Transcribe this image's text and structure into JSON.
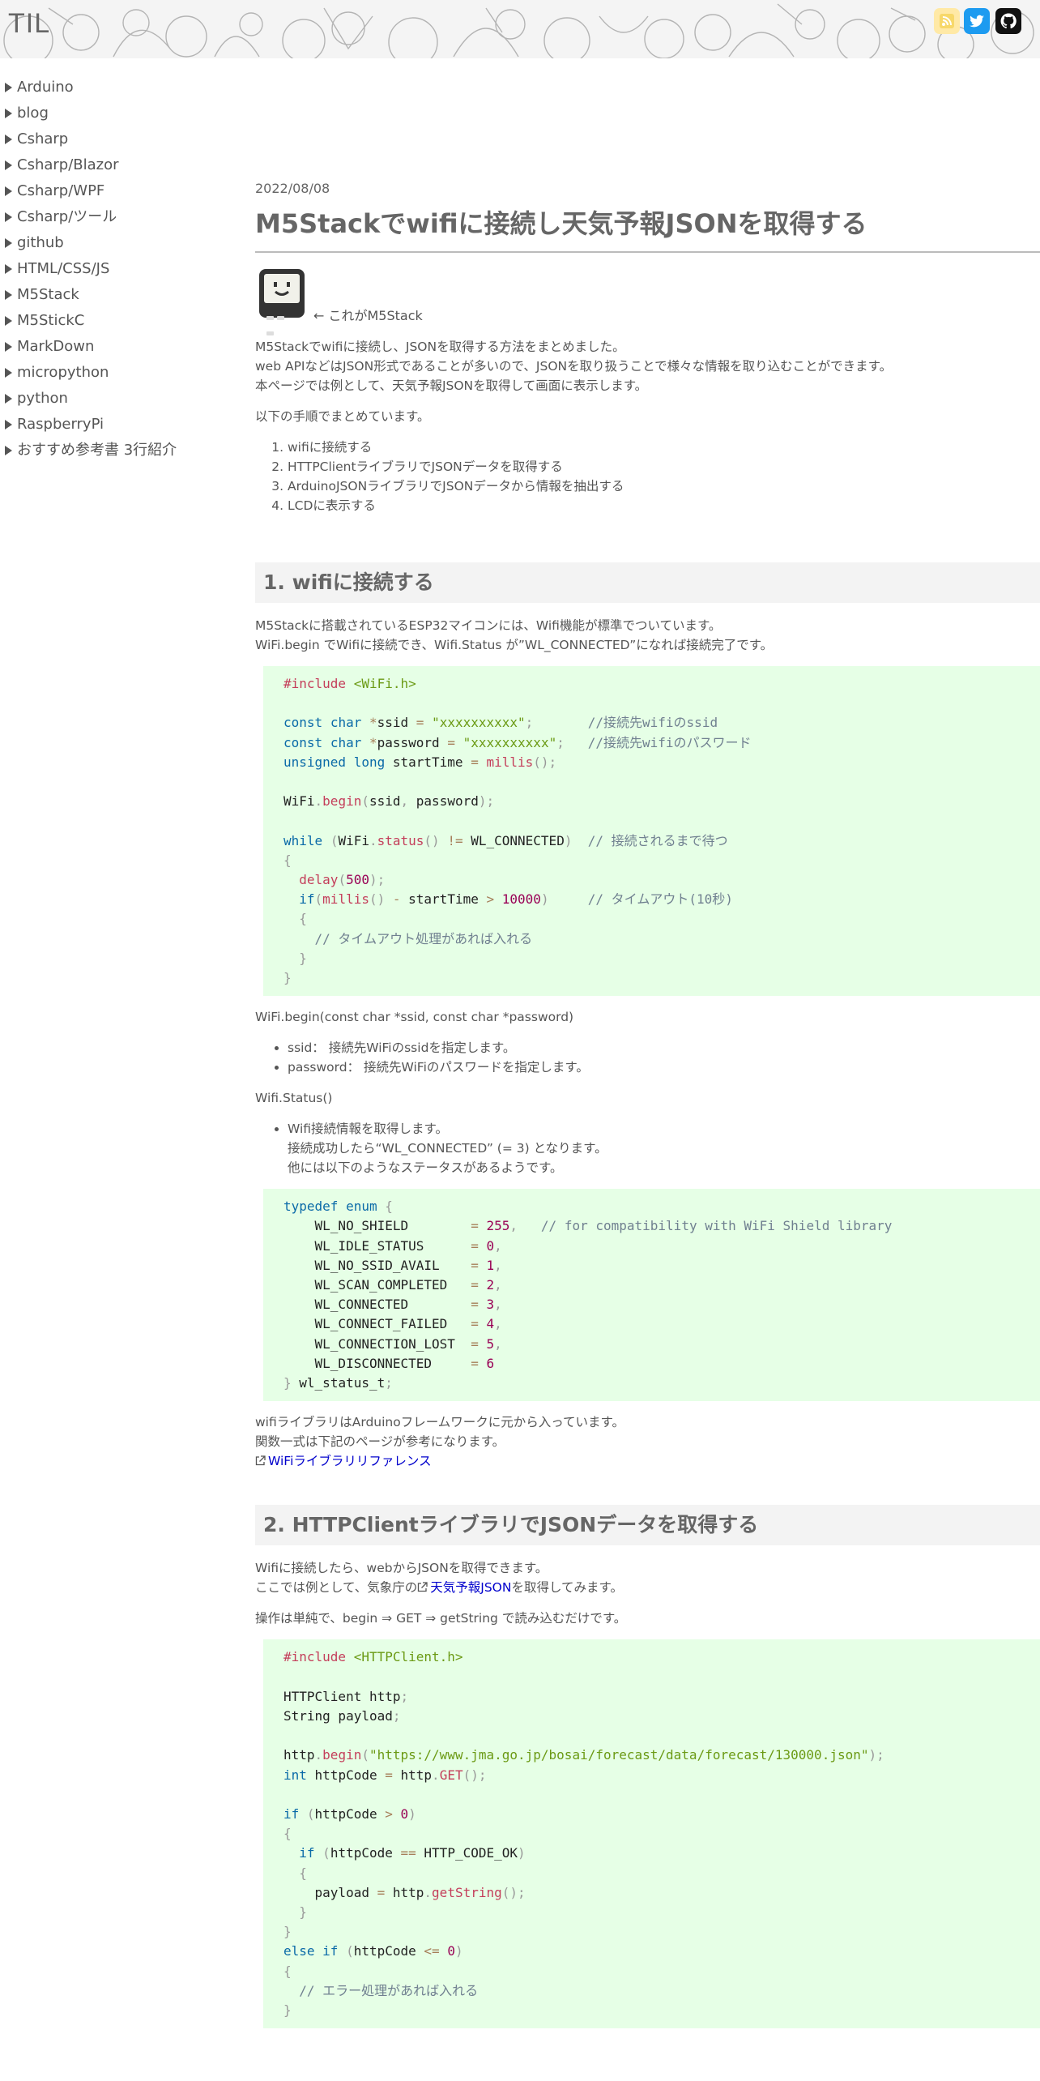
{
  "site": {
    "title": "TIL"
  },
  "sidebar": {
    "items": [
      "Arduino",
      "blog",
      "Csharp",
      "Csharp/Blazor",
      "Csharp/WPF",
      "Csharp/ツール",
      "github",
      "HTML/CSS/JS",
      "M5Stack",
      "M5StickC",
      "MarkDown",
      "micropython",
      "python",
      "RaspberryPi",
      "おすすめ参考書 3行紹介"
    ]
  },
  "article": {
    "date": "2022/08/08",
    "title": "M5Stackでwifiに接続し天気予報JSONを取得する",
    "image_caption": "← これがM5Stack",
    "intro": [
      "M5Stackでwifiに接続し、JSONを取得する方法をまとめました。",
      "web APIなどはJSON形式であることが多いので、JSONを取り扱うことで様々な情報を取り込むことができます。",
      "本ページでは例として、天気予報JSONを取得して画面に表示します。"
    ],
    "steps_intro": "以下の手順でまとめています。",
    "steps": [
      "wifiに接続する",
      "HTTPClientライブラリでJSONデータを取得する",
      "ArduinoJSONライブラリでJSONデータから情報を抽出する",
      "LCDに表示する"
    ],
    "section1": {
      "heading": "1. wifiに接続する",
      "lines": [
        "M5Stackに搭載されているESP32マイコンには、Wifi機能が標準でついています。",
        "WiFi.begin でWifiに接続でき、Wifi.Status が”WL_CONNECTED”になれば接続完了です。"
      ],
      "begin_sig": "WiFi.begin(const char *ssid, const char *password)",
      "begin_params": [
        "ssid： 接続先WiFiのssidを指定します。",
        "password： 接続先WiFiのパスワードを指定します。"
      ],
      "status_sig": "Wifi.Status()",
      "status_desc": [
        "Wifi接続情報を取得します。",
        "接続成功したら“WL_CONNECTED” (= 3) となります。",
        "他には以下のようなステータスがあるようです。"
      ],
      "after_lines": [
        "wifiライブラリはArduinoフレームワークに元から入っています。",
        "関数一式は下記のページが参考になります。"
      ],
      "ref_link": "WiFiライブラリリファレンス"
    },
    "section2": {
      "heading": "2. HTTPClientライブラリでJSONデータを取得する",
      "line1": "Wifiに接続したら、webからJSONを取得できます。",
      "line2_pre": "ここでは例として、気象庁の",
      "line2_link": "天気予報JSON",
      "line2_post": "を取得してみます。",
      "line3": "操作は単純で、begin ⇒ GET ⇒ getString で読み込むだけです。"
    },
    "code1": {
      "include": "#include",
      "include_file": "<WiFi.h>",
      "ssid_val": "\"xxxxxxxxxx\"",
      "pw_val": "\"xxxxxxxxxx\"",
      "c_ssid": "//接続先wifiのssid",
      "c_pw": "//接続先wifiのパスワード",
      "c_wait": "// 接続されるまで待つ",
      "c_timeout": "// タイムアウト(10秒)",
      "c_handle": "// タイムアウト処理があれば入れる",
      "n500": "500",
      "n10000": "10000"
    },
    "code2": {
      "comment": "// for compatibility with WiFi Shield library",
      "entries": [
        {
          "name": "WL_NO_SHIELD",
          "value": "255"
        },
        {
          "name": "WL_IDLE_STATUS",
          "value": "0"
        },
        {
          "name": "WL_NO_SSID_AVAIL",
          "value": "1"
        },
        {
          "name": "WL_SCAN_COMPLETED",
          "value": "2"
        },
        {
          "name": "WL_CONNECTED",
          "value": "3"
        },
        {
          "name": "WL_CONNECT_FAILED",
          "value": "4"
        },
        {
          "name": "WL_CONNECTION_LOST",
          "value": "5"
        },
        {
          "name": "WL_DISCONNECTED",
          "value": "6"
        }
      ],
      "typename": "wl_status_t"
    },
    "code3": {
      "include_file": "<HTTPClient.h>",
      "url": "\"https://www.jma.go.jp/bosai/forecast/data/forecast/130000.json\"",
      "c_err": "// エラー処理があれば入れる"
    }
  },
  "colors": {
    "code_bg": "#e6ffe6",
    "heading_bg": "#f3f3f3",
    "link": "#0000cc"
  }
}
